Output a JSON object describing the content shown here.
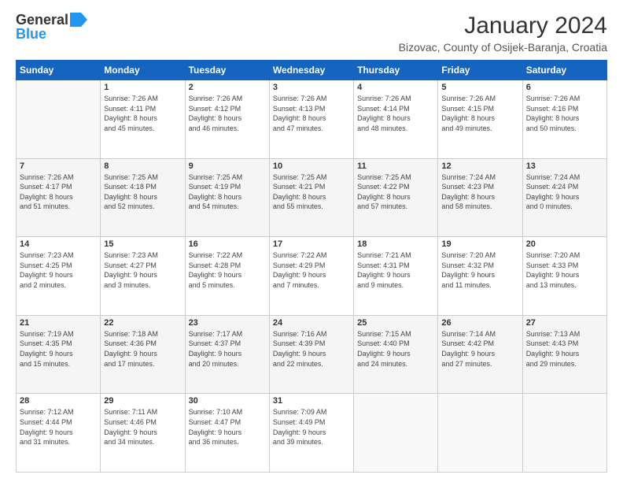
{
  "logo": {
    "general": "General",
    "blue": "Blue"
  },
  "title": "January 2024",
  "location": "Bizovac, County of Osijek-Baranja, Croatia",
  "days_header": [
    "Sunday",
    "Monday",
    "Tuesday",
    "Wednesday",
    "Thursday",
    "Friday",
    "Saturday"
  ],
  "weeks": [
    [
      {
        "day": "",
        "info": ""
      },
      {
        "day": "1",
        "info": "Sunrise: 7:26 AM\nSunset: 4:11 PM\nDaylight: 8 hours\nand 45 minutes."
      },
      {
        "day": "2",
        "info": "Sunrise: 7:26 AM\nSunset: 4:12 PM\nDaylight: 8 hours\nand 46 minutes."
      },
      {
        "day": "3",
        "info": "Sunrise: 7:26 AM\nSunset: 4:13 PM\nDaylight: 8 hours\nand 47 minutes."
      },
      {
        "day": "4",
        "info": "Sunrise: 7:26 AM\nSunset: 4:14 PM\nDaylight: 8 hours\nand 48 minutes."
      },
      {
        "day": "5",
        "info": "Sunrise: 7:26 AM\nSunset: 4:15 PM\nDaylight: 8 hours\nand 49 minutes."
      },
      {
        "day": "6",
        "info": "Sunrise: 7:26 AM\nSunset: 4:16 PM\nDaylight: 8 hours\nand 50 minutes."
      }
    ],
    [
      {
        "day": "7",
        "info": "Sunrise: 7:26 AM\nSunset: 4:17 PM\nDaylight: 8 hours\nand 51 minutes."
      },
      {
        "day": "8",
        "info": "Sunrise: 7:25 AM\nSunset: 4:18 PM\nDaylight: 8 hours\nand 52 minutes."
      },
      {
        "day": "9",
        "info": "Sunrise: 7:25 AM\nSunset: 4:19 PM\nDaylight: 8 hours\nand 54 minutes."
      },
      {
        "day": "10",
        "info": "Sunrise: 7:25 AM\nSunset: 4:21 PM\nDaylight: 8 hours\nand 55 minutes."
      },
      {
        "day": "11",
        "info": "Sunrise: 7:25 AM\nSunset: 4:22 PM\nDaylight: 8 hours\nand 57 minutes."
      },
      {
        "day": "12",
        "info": "Sunrise: 7:24 AM\nSunset: 4:23 PM\nDaylight: 8 hours\nand 58 minutes."
      },
      {
        "day": "13",
        "info": "Sunrise: 7:24 AM\nSunset: 4:24 PM\nDaylight: 9 hours\nand 0 minutes."
      }
    ],
    [
      {
        "day": "14",
        "info": "Sunrise: 7:23 AM\nSunset: 4:25 PM\nDaylight: 9 hours\nand 2 minutes."
      },
      {
        "day": "15",
        "info": "Sunrise: 7:23 AM\nSunset: 4:27 PM\nDaylight: 9 hours\nand 3 minutes."
      },
      {
        "day": "16",
        "info": "Sunrise: 7:22 AM\nSunset: 4:28 PM\nDaylight: 9 hours\nand 5 minutes."
      },
      {
        "day": "17",
        "info": "Sunrise: 7:22 AM\nSunset: 4:29 PM\nDaylight: 9 hours\nand 7 minutes."
      },
      {
        "day": "18",
        "info": "Sunrise: 7:21 AM\nSunset: 4:31 PM\nDaylight: 9 hours\nand 9 minutes."
      },
      {
        "day": "19",
        "info": "Sunrise: 7:20 AM\nSunset: 4:32 PM\nDaylight: 9 hours\nand 11 minutes."
      },
      {
        "day": "20",
        "info": "Sunrise: 7:20 AM\nSunset: 4:33 PM\nDaylight: 9 hours\nand 13 minutes."
      }
    ],
    [
      {
        "day": "21",
        "info": "Sunrise: 7:19 AM\nSunset: 4:35 PM\nDaylight: 9 hours\nand 15 minutes."
      },
      {
        "day": "22",
        "info": "Sunrise: 7:18 AM\nSunset: 4:36 PM\nDaylight: 9 hours\nand 17 minutes."
      },
      {
        "day": "23",
        "info": "Sunrise: 7:17 AM\nSunset: 4:37 PM\nDaylight: 9 hours\nand 20 minutes."
      },
      {
        "day": "24",
        "info": "Sunrise: 7:16 AM\nSunset: 4:39 PM\nDaylight: 9 hours\nand 22 minutes."
      },
      {
        "day": "25",
        "info": "Sunrise: 7:15 AM\nSunset: 4:40 PM\nDaylight: 9 hours\nand 24 minutes."
      },
      {
        "day": "26",
        "info": "Sunrise: 7:14 AM\nSunset: 4:42 PM\nDaylight: 9 hours\nand 27 minutes."
      },
      {
        "day": "27",
        "info": "Sunrise: 7:13 AM\nSunset: 4:43 PM\nDaylight: 9 hours\nand 29 minutes."
      }
    ],
    [
      {
        "day": "28",
        "info": "Sunrise: 7:12 AM\nSunset: 4:44 PM\nDaylight: 9 hours\nand 31 minutes."
      },
      {
        "day": "29",
        "info": "Sunrise: 7:11 AM\nSunset: 4:46 PM\nDaylight: 9 hours\nand 34 minutes."
      },
      {
        "day": "30",
        "info": "Sunrise: 7:10 AM\nSunset: 4:47 PM\nDaylight: 9 hours\nand 36 minutes."
      },
      {
        "day": "31",
        "info": "Sunrise: 7:09 AM\nSunset: 4:49 PM\nDaylight: 9 hours\nand 39 minutes."
      },
      {
        "day": "",
        "info": ""
      },
      {
        "day": "",
        "info": ""
      },
      {
        "day": "",
        "info": ""
      }
    ]
  ]
}
